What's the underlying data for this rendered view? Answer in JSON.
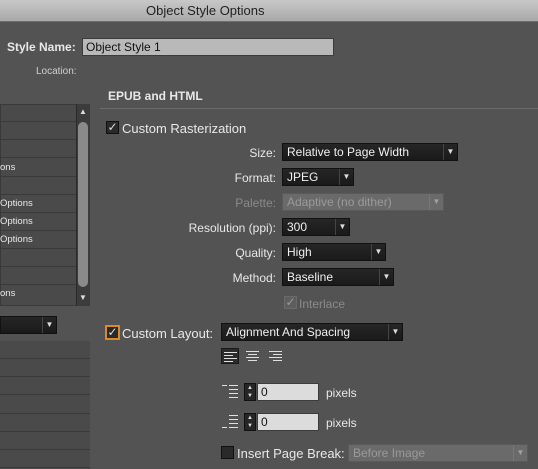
{
  "window": {
    "title": "Object Style Options"
  },
  "style_name": {
    "label": "Style Name:",
    "value": "Object Style 1"
  },
  "location": {
    "label": "Location:"
  },
  "left_list": {
    "rows": [
      "",
      "",
      "",
      "ons",
      "",
      "Options",
      "Options",
      "Options",
      "",
      "",
      "ons"
    ]
  },
  "section": {
    "title": "EPUB and HTML"
  },
  "custom_rasterization": {
    "label": "Custom Rasterization",
    "checked": true
  },
  "size": {
    "label": "Size:",
    "value": "Relative to Page Width"
  },
  "format": {
    "label": "Format:",
    "value": "JPEG"
  },
  "palette": {
    "label": "Palette:",
    "value": "Adaptive (no dither)",
    "disabled": true
  },
  "resolution": {
    "label": "Resolution (ppi):",
    "value": "300"
  },
  "quality": {
    "label": "Quality:",
    "value": "High"
  },
  "method": {
    "label": "Method:",
    "value": "Baseline"
  },
  "interlace": {
    "label": "Interlace",
    "checked": true,
    "disabled": true
  },
  "custom_layout": {
    "label": "Custom Layout:",
    "checked": true,
    "value": "Alignment And Spacing"
  },
  "space_before": {
    "value": "0",
    "unit": "pixels"
  },
  "space_after": {
    "value": "0",
    "unit": "pixels"
  },
  "page_break": {
    "label": "Insert Page Break:",
    "checked": false,
    "value": "Before Image",
    "disabled": true
  },
  "icons": {
    "checkmark": "✓",
    "dropdown_arrow": "▼",
    "scroll_up": "▲",
    "scroll_down": "▼",
    "stepper_up": "▲",
    "stepper_down": "▼"
  },
  "colors": {
    "panel": "#535353",
    "focus_ring": "#d98a2b",
    "popup_bg": "#1f1f1f"
  }
}
